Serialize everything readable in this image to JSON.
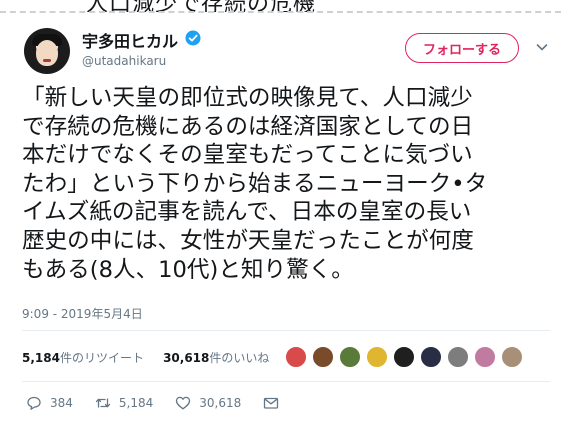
{
  "header": {
    "top_cut_text": "人口減少で存続の危機"
  },
  "account": {
    "display_name": "宇多田ヒカル",
    "handle": "@utadahikaru",
    "follow_label": "フォローする"
  },
  "tweet": {
    "text": "「新しい天皇の即位式の映像見て、人口減少\nで存続の危機にあるのは経済国家としての日\n本だけでなくその皇室もだってことに気づい\nたわ」という下りから始まるニューヨーク•タ\nイムズ紙の記事を読んで、日本の皇室の長い\n歴史の中には、女性が天皇だったことが何度\nもある(8人、10代)と知り驚く。",
    "timestamp": "9:09 - 2019年5月4日"
  },
  "stats": {
    "retweets_count": "5,184",
    "retweets_label": "件のリツイート",
    "likes_count": "30,618",
    "likes_label": "件のいいね"
  },
  "liker_colors": [
    "#d94b4b",
    "#7a4b2a",
    "#5a7a3a",
    "#e0b530",
    "#1f1f1f",
    "#2a2e44",
    "#7d7d7d",
    "#c27ba0",
    "#a89078"
  ],
  "actions": {
    "replies": "384",
    "retweets": "5,184",
    "likes": "30,618"
  },
  "colors": {
    "accent": "#e0245e",
    "verified": "#1da1f2",
    "muted": "#657786"
  }
}
